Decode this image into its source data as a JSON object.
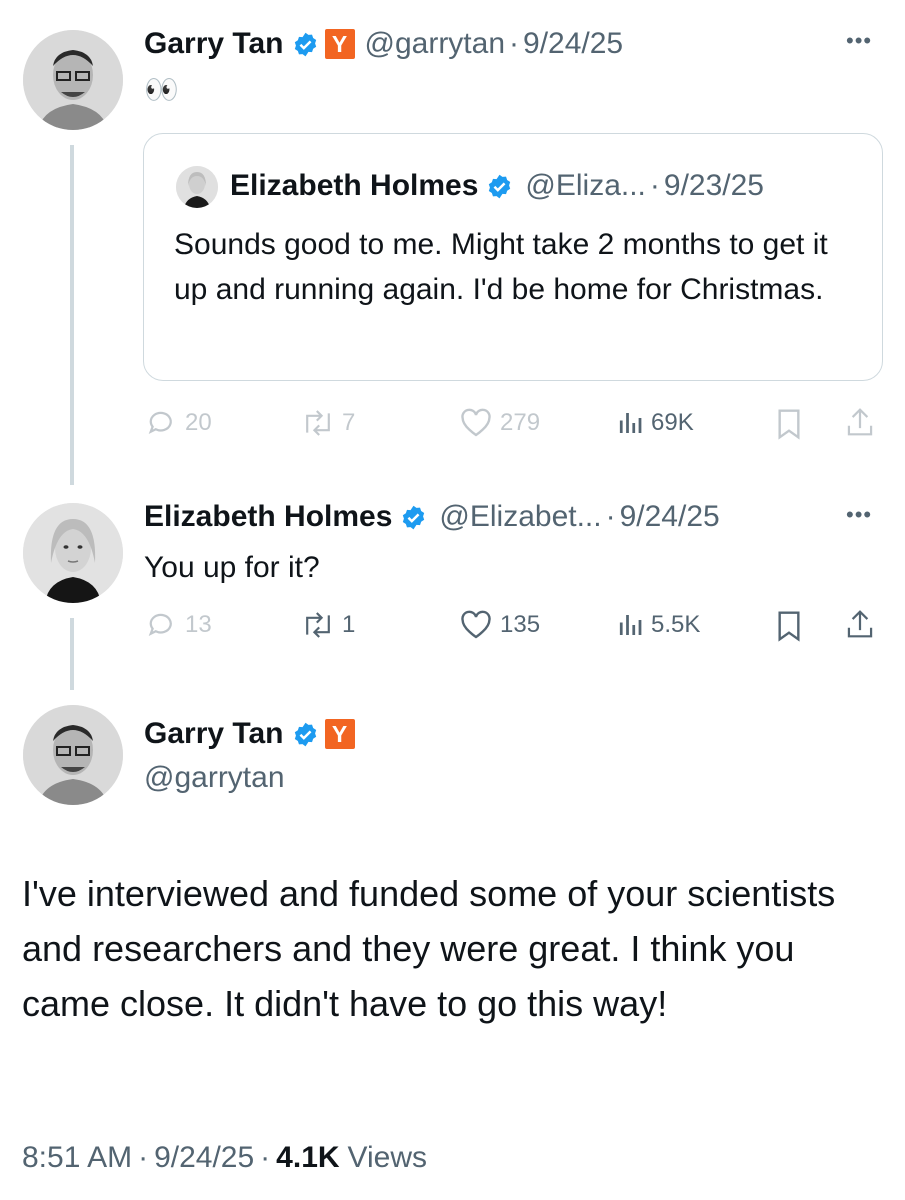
{
  "tweet1": {
    "author_name": "Garry Tan",
    "handle": "@garrytan",
    "separator": "·",
    "date": "9/24/25",
    "badge_label": "Y",
    "emoji": "👀",
    "quote": {
      "author_name": "Elizabeth Holmes",
      "handle": "@Eliza...",
      "separator": "·",
      "date": "9/23/25",
      "text": "Sounds good to me. Might take 2 months to get it up and running again. I'd be home for Christmas."
    },
    "actions": {
      "replies": "20",
      "reposts": "7",
      "likes": "279",
      "views": "69K"
    }
  },
  "tweet2": {
    "author_name": "Elizabeth Holmes",
    "handle": "@Elizabet...",
    "separator": "·",
    "date": "9/24/25",
    "text": "You up for it?",
    "actions": {
      "replies": "13",
      "reposts": "1",
      "likes": "135",
      "views": "5.5K"
    }
  },
  "main": {
    "author_name": "Garry Tan",
    "handle": "@garrytan",
    "badge_label": "Y",
    "text": "I've interviewed and funded some of your scientists and researchers and they were great. I think you came close. It didn't have to go this way!",
    "time": "8:51 AM",
    "date": "9/24/25",
    "views_count": "4.1K",
    "views_label": "Views",
    "separator": "·"
  },
  "colors": {
    "accent": "#1d9bf0",
    "yc_orange": "#f26522",
    "muted": "#536471",
    "border": "#cfd9de"
  },
  "icons": [
    "verified-badge-icon",
    "reply-icon",
    "repost-icon",
    "like-icon",
    "views-icon",
    "bookmark-icon",
    "share-icon",
    "more-icon"
  ]
}
